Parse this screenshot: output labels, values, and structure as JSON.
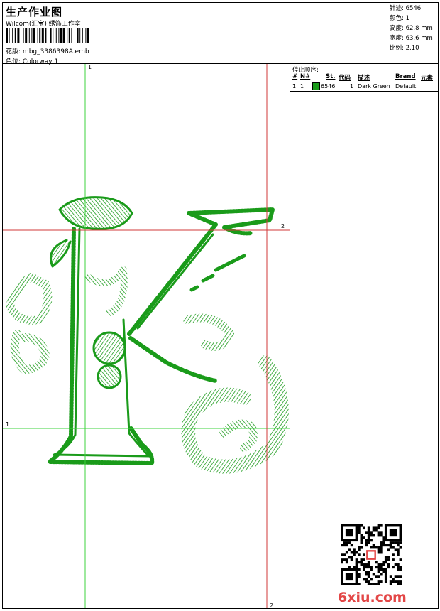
{
  "header": {
    "title": "生产作业图",
    "company": "Wilcom(汇宝) 绣饰工作室",
    "design_label": "花版:",
    "design_value": "mbg_3386398A.emb",
    "colorway_label": "色位:",
    "colorway_value": "Colorway 1"
  },
  "stats": {
    "stitches_label": "针迹:",
    "stitches_value": "6546",
    "colors_label": "颜色:",
    "colors_value": "1",
    "height_label": "高度:",
    "height_value": "62.8 mm",
    "width_label": "宽度:",
    "width_value": "63.6 mm",
    "scale_label": "比例:",
    "scale_value": "2.10"
  },
  "stop_sequence": {
    "title": "停止顺序:",
    "columns": [
      "#",
      "N#",
      "St.",
      "代码",
      "描述",
      "Brand",
      "元素"
    ],
    "rows": [
      {
        "index": "1.",
        "needle": "1",
        "swatch_color": "#1a9b1a",
        "stitches": "6546",
        "code": "1",
        "description": "Dark Green",
        "brand": "Default"
      }
    ]
  },
  "guides": {
    "green_vertical_label": "1",
    "green_horizontal_label": "1",
    "red_horizontal_label": "2",
    "red_vertical_label": "2"
  },
  "watermark": "6xiu.com",
  "colors": {
    "embroidery": "#1a9b1a",
    "guide_green": "#3cd33c",
    "guide_red": "#d23a3a",
    "watermark": "#e34747"
  }
}
